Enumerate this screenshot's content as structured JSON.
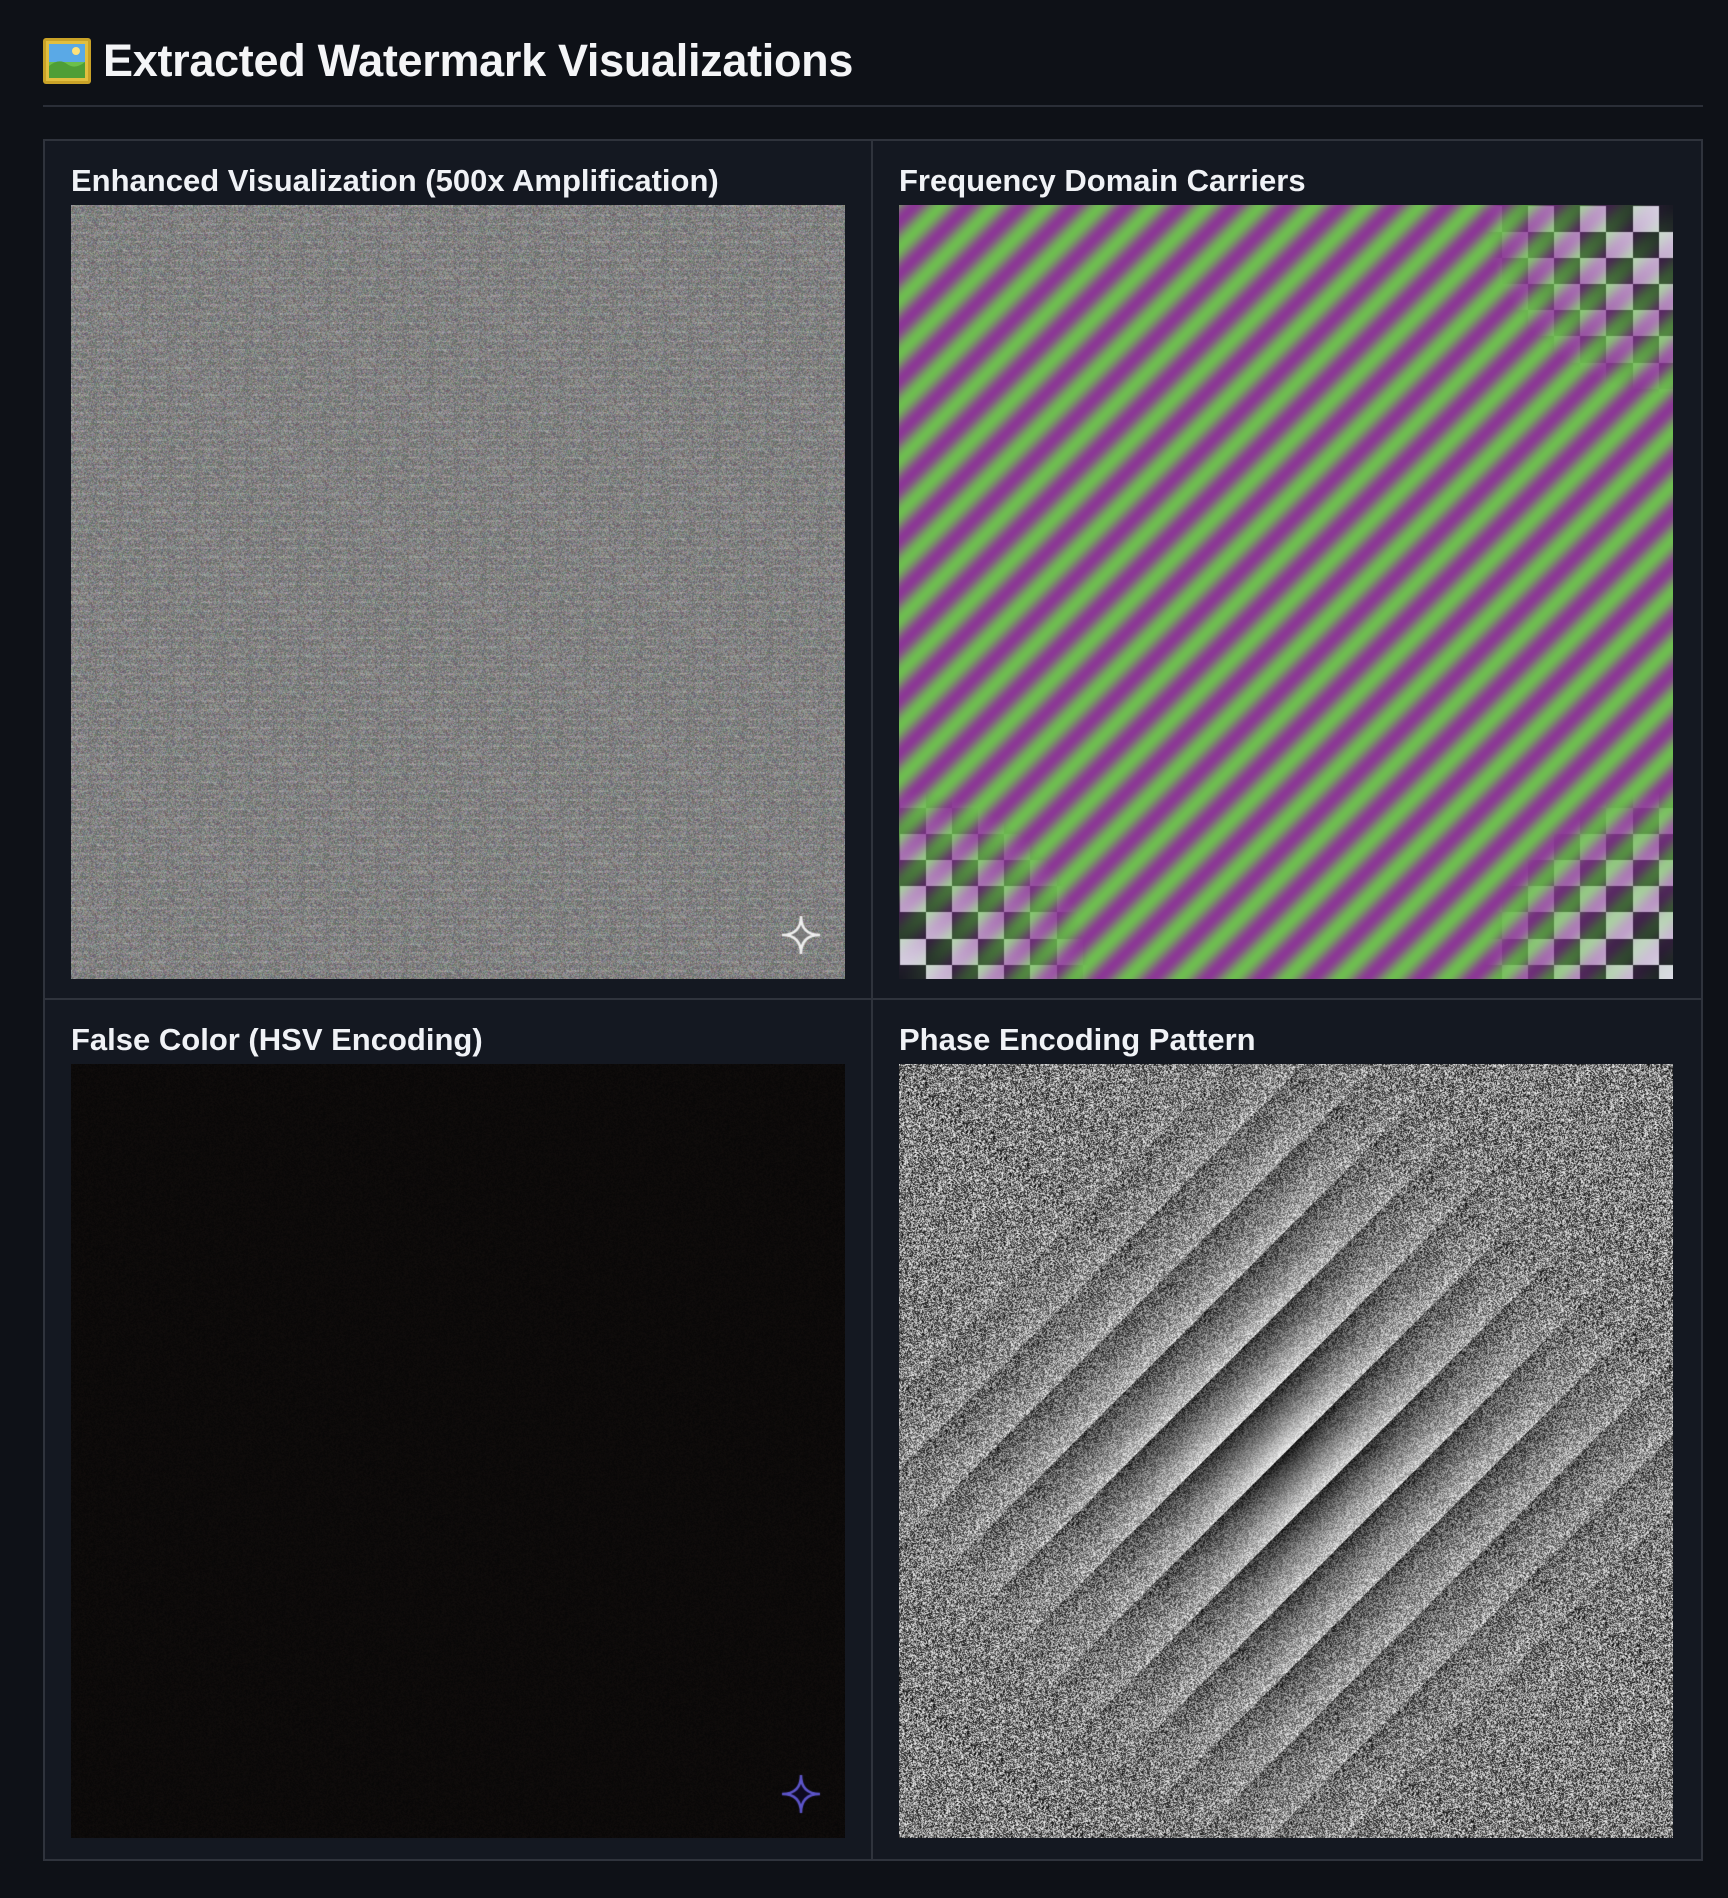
{
  "header": {
    "icon": "framed-picture-icon",
    "title": "Extracted Watermark Visualizations"
  },
  "panels": [
    {
      "id": "enhanced",
      "title": "Enhanced Visualization (500x Amplification)",
      "icon": "sparkle-icon"
    },
    {
      "id": "frequency",
      "title": "Frequency Domain Carriers"
    },
    {
      "id": "false-color",
      "title": "False Color (HSV Encoding)",
      "icon": "sparkle-icon"
    },
    {
      "id": "phase",
      "title": "Phase Encoding Pattern"
    }
  ],
  "colors": {
    "background": "#0e1117",
    "panel_background": "#141821",
    "border": "#2f333c",
    "text": "#f0f2f6",
    "carrier_magenta": "#8a3b94",
    "carrier_green": "#6fbf53"
  }
}
